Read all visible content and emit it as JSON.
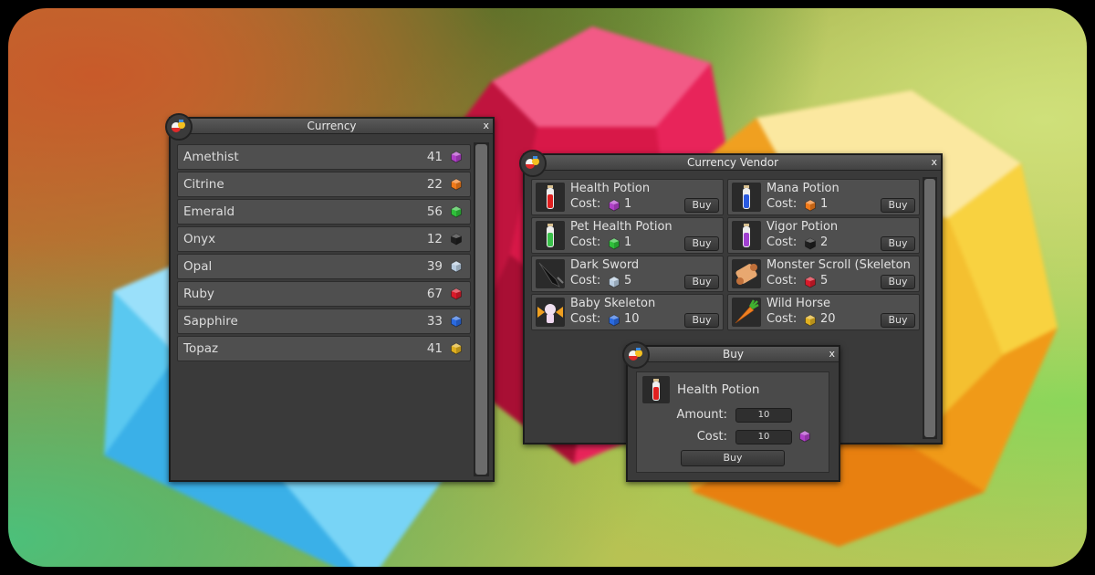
{
  "currency_window": {
    "title": "Currency",
    "close_label": "x",
    "rows": [
      {
        "name": "Amethist",
        "amount": "41",
        "gem_color": "#b040c8"
      },
      {
        "name": "Citrine",
        "amount": "22",
        "gem_color": "#f07a1a"
      },
      {
        "name": "Emerald",
        "amount": "56",
        "gem_color": "#2fbf3a"
      },
      {
        "name": "Onyx",
        "amount": "12",
        "gem_color": "#1e1e1e"
      },
      {
        "name": "Opal",
        "amount": "39",
        "gem_color": "#b8cce0"
      },
      {
        "name": "Ruby",
        "amount": "67",
        "gem_color": "#d81a2a"
      },
      {
        "name": "Sapphire",
        "amount": "33",
        "gem_color": "#2a6ae0"
      },
      {
        "name": "Topaz",
        "amount": "41",
        "gem_color": "#e0b020"
      }
    ]
  },
  "vendor_window": {
    "title": "Currency Vendor",
    "close_label": "x",
    "cost_label": "Cost:",
    "buy_label": "Buy",
    "items": [
      {
        "name": "Health Potion",
        "cost": "1",
        "gem_color": "#b040c8",
        "icon": "red-potion-icon"
      },
      {
        "name": "Mana Potion",
        "cost": "1",
        "gem_color": "#f07a1a",
        "icon": "blue-potion-icon"
      },
      {
        "name": "Pet Health Potion",
        "cost": "1",
        "gem_color": "#2fbf3a",
        "icon": "green-potion-icon"
      },
      {
        "name": "Vigor Potion",
        "cost": "2",
        "gem_color": "#1e1e1e",
        "icon": "purple-potion-icon"
      },
      {
        "name": "Dark Sword",
        "cost": "5",
        "gem_color": "#b8cce0",
        "icon": "sword-icon"
      },
      {
        "name": "Monster Scroll (Skeleton",
        "cost": "5",
        "gem_color": "#d81a2a",
        "icon": "scroll-icon"
      },
      {
        "name": "Baby Skeleton",
        "cost": "10",
        "gem_color": "#2a6ae0",
        "icon": "skeleton-pet-icon"
      },
      {
        "name": "Wild Horse",
        "cost": "20",
        "gem_color": "#e0b020",
        "icon": "carrot-icon"
      }
    ]
  },
  "buy_dialog": {
    "title": "Buy",
    "close_label": "x",
    "item_name": "Health Potion",
    "amount_label": "Amount:",
    "amount_value": "10",
    "cost_label": "Cost:",
    "cost_value": "10",
    "cost_gem_color": "#b040c8",
    "buy_label": "Buy"
  }
}
